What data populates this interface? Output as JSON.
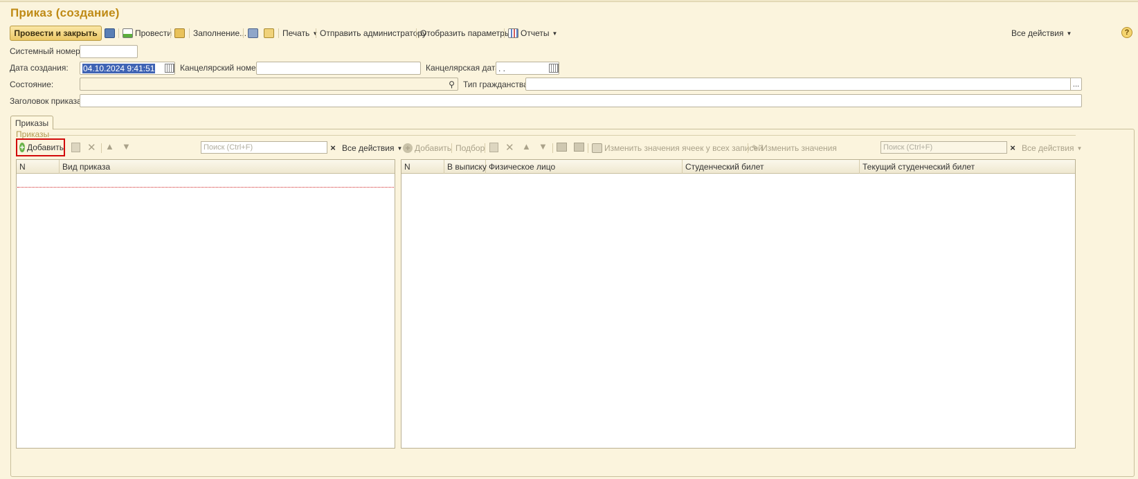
{
  "window": {
    "title": "Приказ (создание)"
  },
  "toolbar": {
    "post_and_close": "Провести и закрыть",
    "post": "Провести",
    "fill": "Заполнение...",
    "print": "Печать",
    "send_admin": "Отправить администратору",
    "show_params": "Отобразить параметры",
    "reports": "Отчеты",
    "all_actions": "Все действия",
    "help": "?"
  },
  "form": {
    "system_number_label": "Системный номер:",
    "system_number_value": "",
    "created_label": "Дата создания:",
    "created_value": "04.10.2024  9:41:51",
    "office_number_label": "Канцелярский номер:",
    "office_number_value": "",
    "office_date_label": "Канцелярская дата:",
    "office_date_value": " .  .",
    "state_label": "Состояние:",
    "state_value": "",
    "citizenship_label": "Тип гражданства:",
    "citizenship_value": "",
    "header_label": "Заголовок приказа:",
    "header_value": ""
  },
  "tabs": [
    {
      "label": "Приказы"
    }
  ],
  "group": {
    "title": "Приказы"
  },
  "left_toolbar": {
    "add": "Добавить",
    "search_placeholder": "Поиск (Ctrl+F)",
    "clear": "×",
    "all_actions": "Все действия"
  },
  "right_toolbar": {
    "add": "Добавить",
    "select": "Подбор",
    "change_all_cells": "Изменить значения ячеек у всех записей",
    "change_values": "Изменить значения",
    "search_placeholder": "Поиск (Ctrl+F)",
    "clear": "×",
    "all_actions": "Все действия"
  },
  "left_table": {
    "columns": [
      "N",
      "Вид приказа"
    ],
    "rows": []
  },
  "right_table": {
    "columns": [
      "N",
      "В выписку",
      "Физическое лицо",
      "Студенческий билет",
      "Текущий студенческий билет"
    ],
    "rows": []
  },
  "colors": {
    "accent": "#bf8a15",
    "background": "#fbf4dd",
    "highlight_border": "#d20a0a"
  }
}
